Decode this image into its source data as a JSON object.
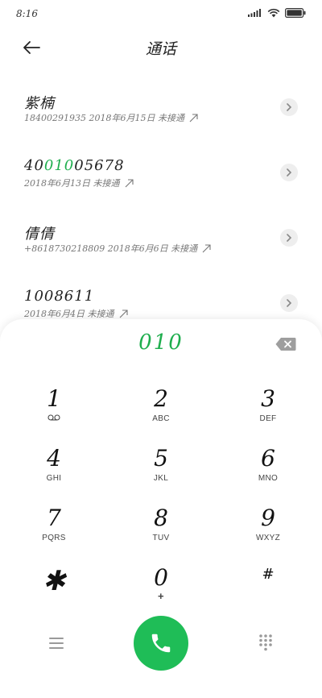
{
  "status_bar": {
    "time": "8:16",
    "icons": [
      "signal-icon",
      "wifi-icon",
      "battery-icon"
    ]
  },
  "header": {
    "title": "通话",
    "back_icon": "arrow-left-icon"
  },
  "calls": [
    {
      "name": "紫楠",
      "meta": "18400291935 2018年6月15日 未接通"
    },
    {
      "name_parts": [
        "40",
        "010",
        "05678"
      ],
      "meta": "2018年6月13日 未接通"
    },
    {
      "name": "倩倩",
      "meta": "+8618730218809 2018年6月6日 未接通"
    },
    {
      "name": "1008611",
      "meta": "2018年6月4日 未接通"
    }
  ],
  "dialpad": {
    "input_value": "010",
    "keys": [
      {
        "digit": "1",
        "letters": ""
      },
      {
        "digit": "2",
        "letters": "ABC"
      },
      {
        "digit": "3",
        "letters": "DEF"
      },
      {
        "digit": "4",
        "letters": "GHI"
      },
      {
        "digit": "5",
        "letters": "JKL"
      },
      {
        "digit": "6",
        "letters": "MNO"
      },
      {
        "digit": "7",
        "letters": "PQRS"
      },
      {
        "digit": "8",
        "letters": "TUV"
      },
      {
        "digit": "9",
        "letters": "WXYZ"
      },
      {
        "digit": "✱",
        "letters": ""
      },
      {
        "digit": "0",
        "letters": "+"
      },
      {
        "digit": "#",
        "letters": ""
      }
    ]
  },
  "colors": {
    "accent": "#1fae4e",
    "call_button": "#1fbd57"
  }
}
